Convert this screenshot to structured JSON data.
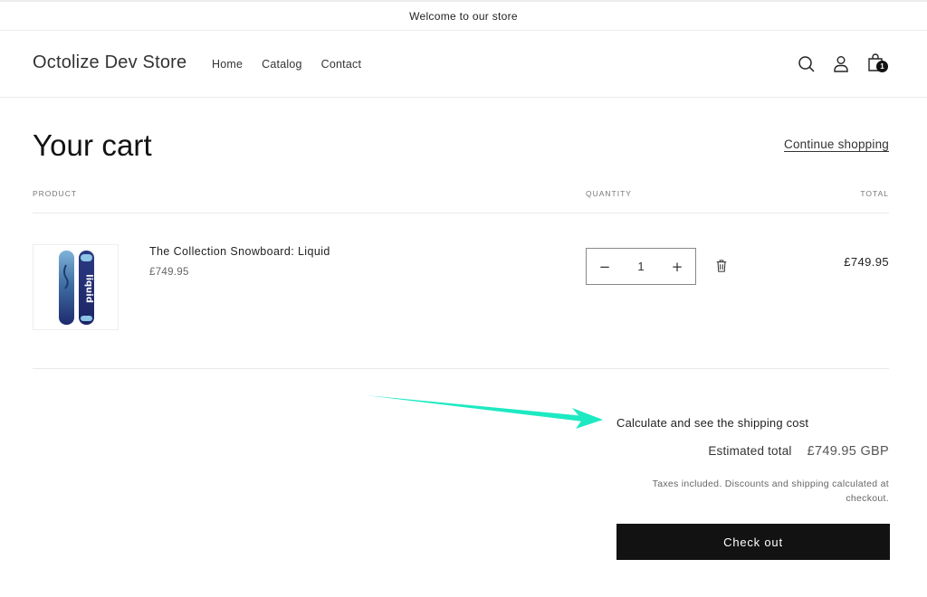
{
  "announcement": {
    "text": "Welcome to our store"
  },
  "header": {
    "logo": "Octolize Dev Store",
    "nav": [
      {
        "label": "Home"
      },
      {
        "label": "Catalog"
      },
      {
        "label": "Contact"
      }
    ],
    "icons": {
      "search": "search-icon",
      "account": "account-icon",
      "cart": "cart-icon"
    },
    "cart_count": "1"
  },
  "cart": {
    "title": "Your cart",
    "continue_shopping": "Continue shopping",
    "columns": {
      "product": "PRODUCT",
      "quantity": "QUANTITY",
      "total": "TOTAL"
    },
    "items": [
      {
        "title": "The Collection Snowboard: Liquid",
        "price": "£749.95",
        "quantity": "1",
        "line_total": "£749.95",
        "image_alt": "Liquid snowboard"
      }
    ],
    "qty_minus": "−",
    "qty_plus": "+",
    "remove_icon": "trash-icon"
  },
  "summary": {
    "shipping_calc": "Calculate and see the shipping cost",
    "estimated_label": "Estimated total",
    "estimated_value": "£749.95 GBP",
    "tax_note": "Taxes included. Discounts and shipping calculated at checkout.",
    "checkout_label": "Check out"
  },
  "annotation": {
    "arrow_color": "#1de9c2"
  },
  "colors": {
    "button_bg": "#121212",
    "divider": "#e8e8e8"
  }
}
